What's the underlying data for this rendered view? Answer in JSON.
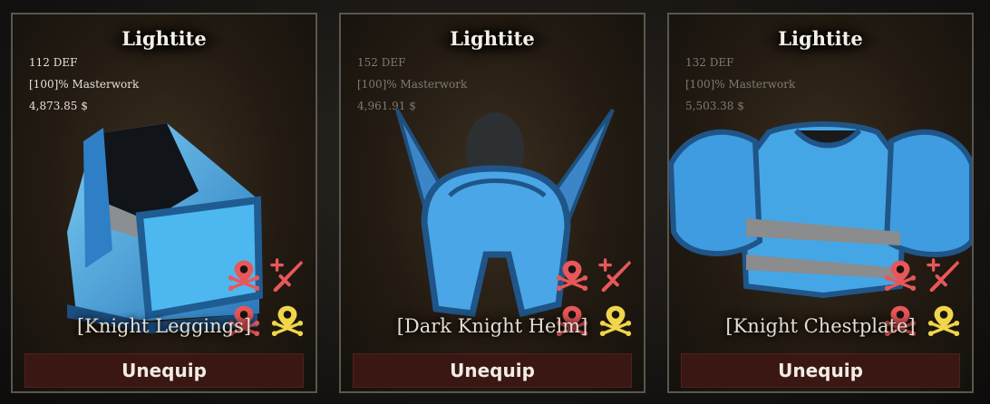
{
  "cards": [
    {
      "title": "Lightite",
      "def": "112 DEF",
      "masterwork": "[100]% Masterwork",
      "price": "4,873.85 $",
      "item_name": "[Knight Leggings]",
      "button": "Unequip",
      "perks": [
        "skull-pin-red-icon",
        "sword-plus-red-icon",
        "skull-pin-red-icon",
        "skull-pin-yellow-icon"
      ]
    },
    {
      "title": "Lightite",
      "def": "152 DEF",
      "masterwork": "[100]% Masterwork",
      "price": "4,961.91 $",
      "item_name": "[Dark Knight Helm]",
      "button": "Unequip",
      "perks": [
        "skull-pin-red-icon",
        "sword-plus-red-icon",
        "skull-pin-red-icon",
        "skull-pin-yellow-icon"
      ]
    },
    {
      "title": "Lightite",
      "def": "132 DEF",
      "masterwork": "[100]% Masterwork",
      "price": "5,503.38 $",
      "item_name": "[Knight Chestplate]",
      "button": "Unequip",
      "perks": [
        "skull-pin-red-icon",
        "sword-plus-red-icon",
        "skull-pin-red-icon",
        "skull-pin-yellow-icon"
      ]
    }
  ],
  "colors": {
    "perk_red": "#e8575a",
    "perk_yellow": "#f1d54a",
    "armor_blue": "#3d9fe0",
    "button_bg": "#3a1713"
  }
}
